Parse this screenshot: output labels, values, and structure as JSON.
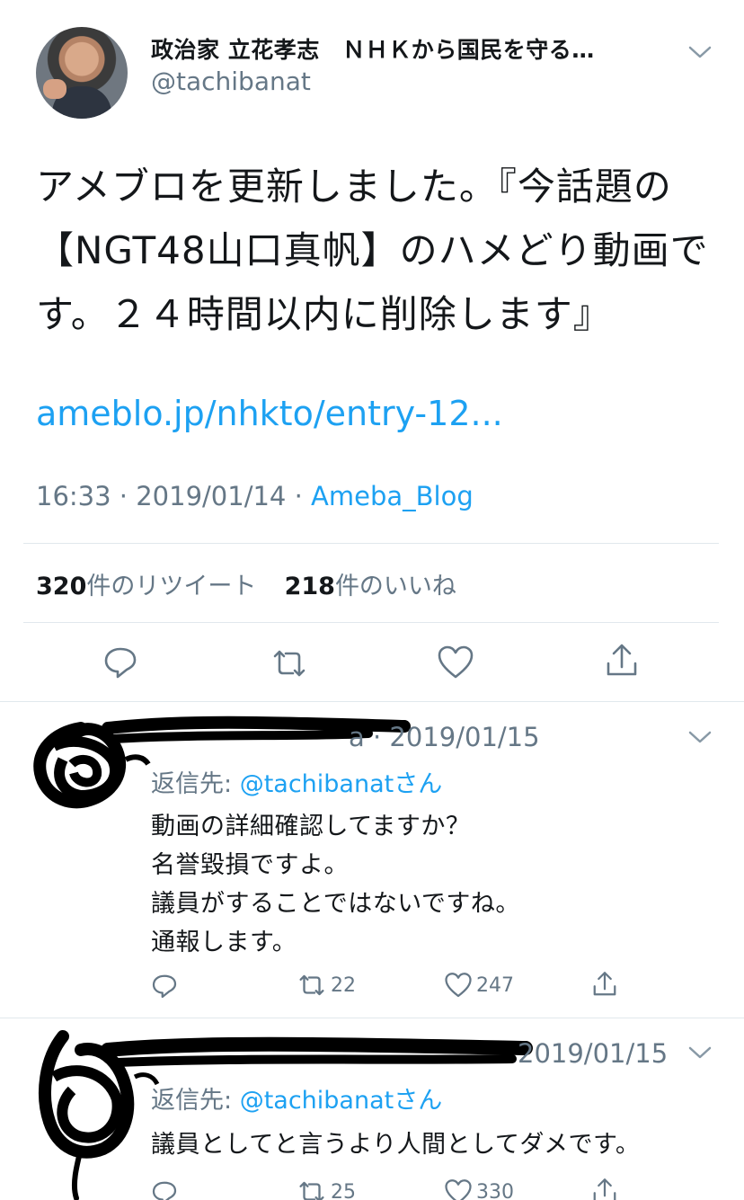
{
  "tweet": {
    "author_name": "政治家 立花孝志　ＮＨＫから国民を守る…",
    "handle": "@tachibanat",
    "text": "アメブロを更新しました。『今話題の【NGT48山口真帆】のハメどり動画です。２４時間以内に削除します』",
    "link": "ameblo.jp/nhkto/entry-12...",
    "time": "16:33 · 2019/01/14 · ",
    "source": "Ameba_Blog",
    "retweets_count": "320",
    "retweets_label": "件のリツイート",
    "likes_count": "218",
    "likes_label": "件のいいね",
    "icons": [
      "reply-icon",
      "retweet-icon",
      "like-icon",
      "share-icon"
    ]
  },
  "replies": [
    {
      "date": "a · 2019/01/15",
      "reply_to_prefix": "返信先: ",
      "reply_to_mention": "@tachibanatさん",
      "body": "動画の詳細確認してますか？\n名誉毀損ですよ。\n議員がすることではないですね。\n通報します。",
      "retweets": "22",
      "likes": "247"
    },
    {
      "date": "2019/01/15",
      "reply_to_prefix": "返信先: ",
      "reply_to_mention": "@tachibanatさん",
      "body": "議員としてと言うより人間としてダメです。",
      "retweets": "25",
      "likes": "330"
    }
  ],
  "colors": {
    "accent": "#1da1f2",
    "secondary_text": "#657786",
    "divider": "#e1e8ed"
  }
}
